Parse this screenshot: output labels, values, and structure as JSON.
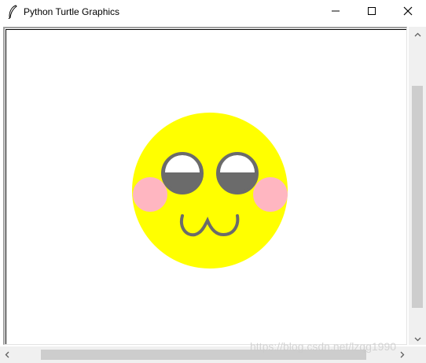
{
  "window": {
    "title": "Python Turtle Graphics",
    "icon": "feather-icon",
    "controls": {
      "minimize_icon": "minimize-icon",
      "maximize_icon": "maximize-icon",
      "close_icon": "close-icon"
    }
  },
  "drawing": {
    "subject": "smiley-face",
    "colors": {
      "face": "#ffff00",
      "blush": "#ffb6c1",
      "eye_outline": "#6b6b6b",
      "eye_white": "#ffffff",
      "mouth": "#6b6b6b",
      "background": "#ffffff"
    }
  },
  "scrollbars": {
    "up_icon": "scroll-up-arrow-icon",
    "down_icon": "scroll-down-arrow-icon",
    "left_icon": "scroll-left-arrow-icon",
    "right_icon": "scroll-right-arrow-icon"
  },
  "watermark": "https://blog.csdn.net/lzqg1990"
}
